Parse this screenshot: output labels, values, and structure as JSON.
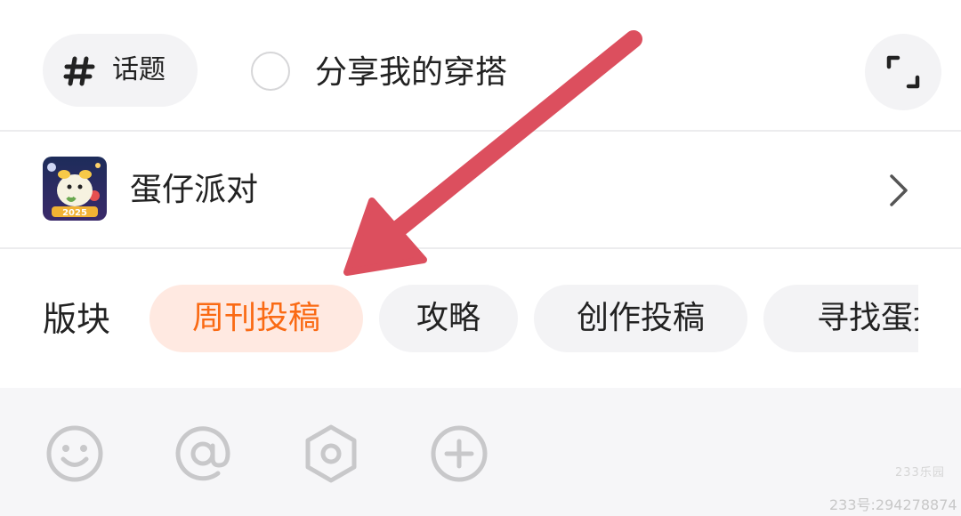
{
  "header": {
    "topic_chip_label": "话题",
    "share_outfit_label": "分享我的穿搭"
  },
  "game": {
    "name": "蛋仔派对",
    "icon_badge_text": "2025"
  },
  "sections": {
    "label": "版块",
    "chips": [
      {
        "label": "周刊投稿",
        "active": true
      },
      {
        "label": "攻略",
        "active": false
      },
      {
        "label": "创作投稿",
        "active": false
      },
      {
        "label": "寻找蛋搭子",
        "active": false
      }
    ]
  },
  "toolbar": {
    "icons": [
      "emoji-icon",
      "at-mention-icon",
      "settings-hexagon-icon",
      "plus-circle-icon"
    ]
  },
  "watermark": {
    "logo_text": "233乐园",
    "id_text": "233号:294278874"
  },
  "colors": {
    "accent": "#fa6a14",
    "accent_bg": "#ffe9e1",
    "annotation_arrow": "#dc4f5e",
    "chip_bg": "#f3f3f5",
    "toolbar_bg": "#f6f6f8"
  }
}
